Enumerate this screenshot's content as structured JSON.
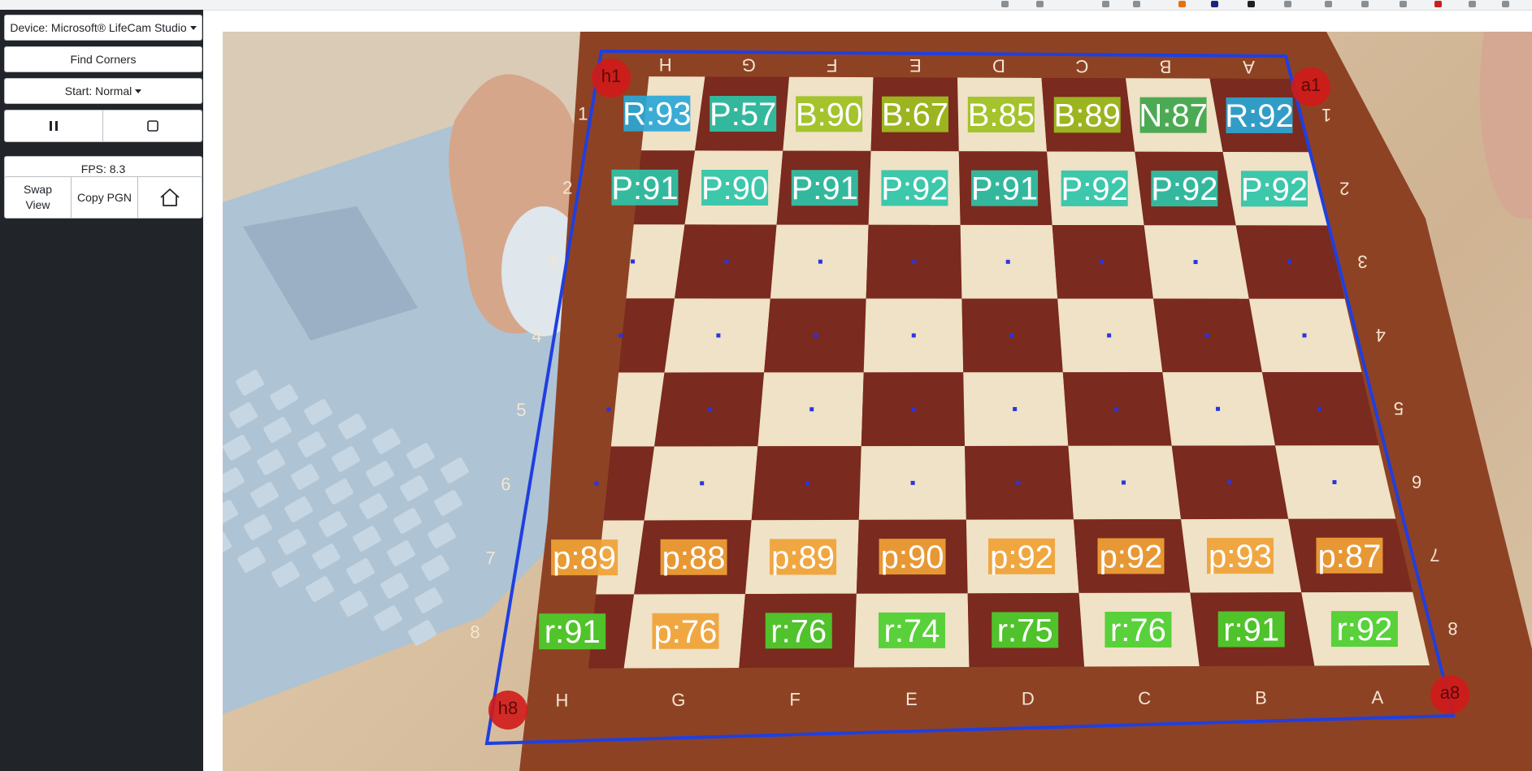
{
  "sidebar": {
    "device_label": "Device: Microsoft® LifeCam Studio",
    "find_corners_label": "Find Corners",
    "start_label": "Start: Normal",
    "fps_label": "FPS: 8.3",
    "swap_view_label": "Swap View",
    "copy_pgn_label": "Copy PGN",
    "icons": {
      "pause": "pause-icon",
      "stop": "stop-icon",
      "home": "home-icon"
    }
  },
  "board": {
    "file_labels": [
      "H",
      "G",
      "F",
      "E",
      "D",
      "C",
      "B",
      "A"
    ],
    "rank_labels": [
      "1",
      "2",
      "3",
      "4",
      "5",
      "6",
      "7",
      "8"
    ],
    "corner_markers": [
      "h1",
      "a1",
      "h8",
      "a8"
    ],
    "detections": [
      [
        {
          "text": "R:93",
          "color": "#2aa7d6"
        },
        {
          "text": "P:57",
          "color": "#2ec4a8"
        },
        {
          "text": "B:90",
          "color": "#9ec01f"
        },
        {
          "text": "B:67",
          "color": "#9ec01f"
        },
        {
          "text": "B:85",
          "color": "#9ec01f"
        },
        {
          "text": "B:89",
          "color": "#9ec01f"
        },
        {
          "text": "N:87",
          "color": "#3fa54a"
        },
        {
          "text": "R:92",
          "color": "#2aa7d6"
        }
      ],
      [
        {
          "text": "P:91",
          "color": "#2ec4a8"
        },
        {
          "text": "P:90",
          "color": "#2ec4a8"
        },
        {
          "text": "P:91",
          "color": "#2ec4a8"
        },
        {
          "text": "P:92",
          "color": "#2ec4a8"
        },
        {
          "text": "P:91",
          "color": "#2ec4a8"
        },
        {
          "text": "P:92",
          "color": "#2ec4a8"
        },
        {
          "text": "P:92",
          "color": "#2ec4a8"
        },
        {
          "text": "P:92",
          "color": "#2ec4a8"
        }
      ],
      [
        {
          "text": "p:89",
          "color": "#f0a236"
        },
        {
          "text": "p:88",
          "color": "#f0a236"
        },
        {
          "text": "p:89",
          "color": "#f0a236"
        },
        {
          "text": "p:90",
          "color": "#f0a236"
        },
        {
          "text": "p:92",
          "color": "#f0a236"
        },
        {
          "text": "p:92",
          "color": "#f0a236"
        },
        {
          "text": "p:93",
          "color": "#f0a236"
        },
        {
          "text": "p:87",
          "color": "#f0a236"
        }
      ],
      [
        {
          "text": "r:91",
          "color": "#4ccf2e"
        },
        {
          "text": "p:76",
          "color": "#f0a236"
        },
        {
          "text": "r:76",
          "color": "#4ccf2e"
        },
        {
          "text": "r:74",
          "color": "#4ccf2e"
        },
        {
          "text": "r:75",
          "color": "#4ccf2e"
        },
        {
          "text": "r:76",
          "color": "#4ccf2e"
        },
        {
          "text": "r:91",
          "color": "#4ccf2e"
        },
        {
          "text": "r:92",
          "color": "#4ccf2e"
        }
      ]
    ]
  },
  "colors": {
    "sidebar_bg": "#212529",
    "board_outline": "#1f3fe0",
    "light_square": "#efe2c6",
    "dark_square": "#7a2a1e",
    "frame": "#8a3f22",
    "corner_marker": "#d21a1a",
    "empty_square_dot": "#2a35e0"
  }
}
